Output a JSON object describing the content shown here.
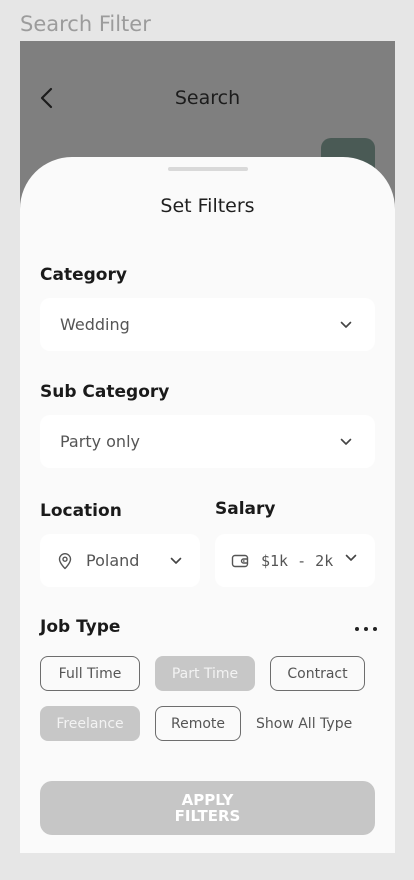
{
  "artboard_label": "Search Filter",
  "header": {
    "title": "Search"
  },
  "sheet": {
    "title": "Set Filters",
    "category": {
      "label": "Category",
      "value": "Wedding"
    },
    "sub_category": {
      "label": "Sub Category",
      "value": "Party only"
    },
    "location": {
      "label": "Location",
      "value": "Poland",
      "icon": "map-pin-icon"
    },
    "salary": {
      "label": "Salary",
      "value": "$1k - 2k",
      "icon": "wallet-icon"
    },
    "job_type": {
      "label": "Job Type",
      "options": [
        {
          "label": "Full Time",
          "selected": false
        },
        {
          "label": "Part Time",
          "selected": true
        },
        {
          "label": "Contract",
          "selected": false
        },
        {
          "label": "Freelance",
          "selected": true
        },
        {
          "label": "Remote",
          "selected": false
        }
      ],
      "show_all": "Show All Type"
    },
    "apply_button": "APPLY FILTERS"
  },
  "colors": {
    "backdrop": "#7f7f7f",
    "sheet": "#fafafa",
    "chip_selected": "#c7c7c7",
    "button_disabled": "#c6c6c6"
  }
}
